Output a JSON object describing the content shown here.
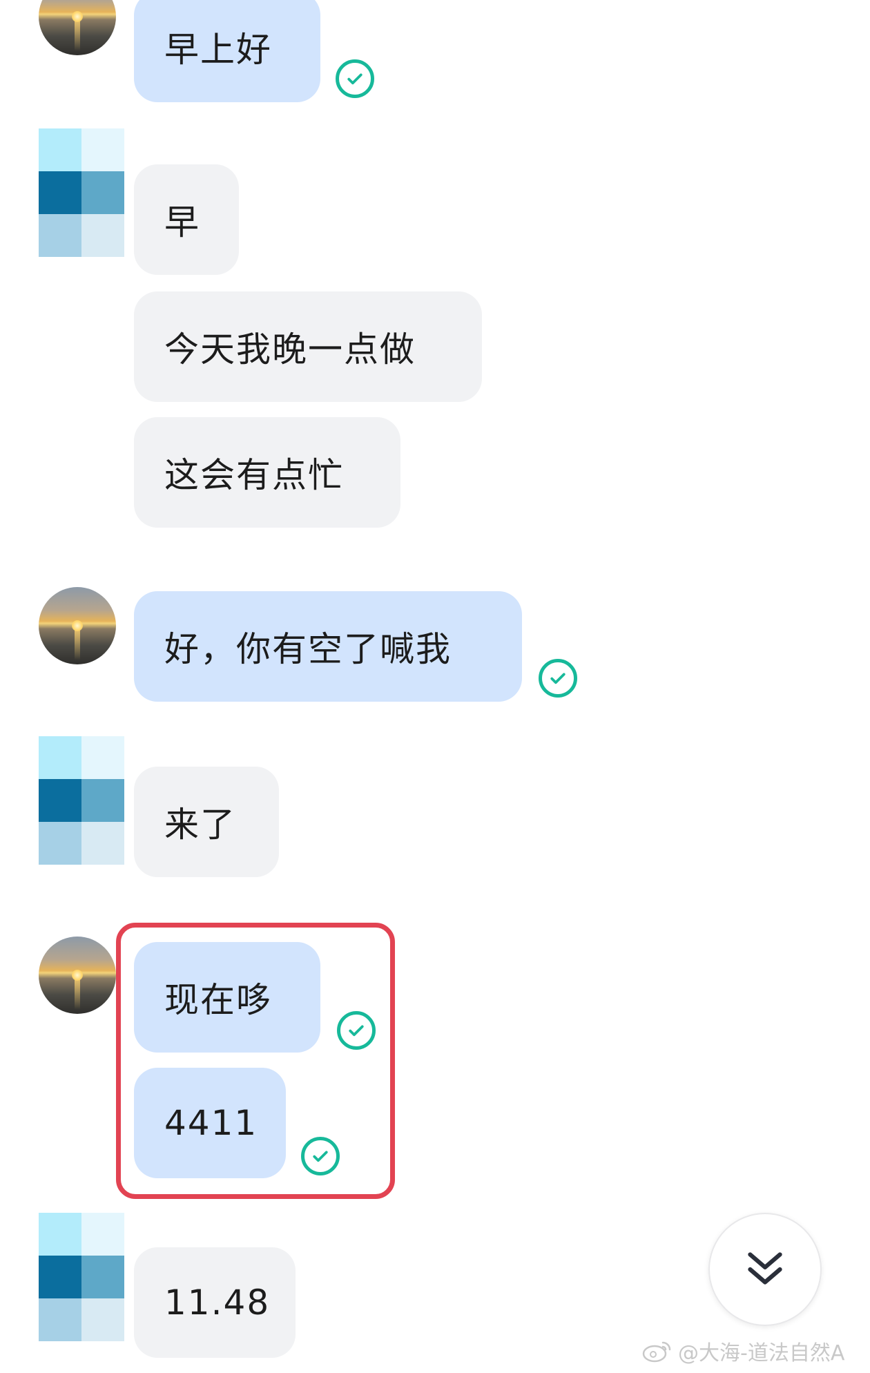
{
  "messages": [
    {
      "text": "早上好",
      "direction": "sent",
      "status": "read"
    },
    {
      "text": "早",
      "direction": "received"
    },
    {
      "text": "今天我晚一点做",
      "direction": "received"
    },
    {
      "text": "这会有点忙",
      "direction": "received"
    },
    {
      "text": "好，你有空了喊我",
      "direction": "sent",
      "status": "read"
    },
    {
      "text": "来了",
      "direction": "received"
    },
    {
      "text": "现在哆",
      "direction": "sent",
      "status": "read",
      "highlighted": true
    },
    {
      "text": "4411",
      "direction": "sent",
      "status": "read",
      "highlighted": true
    },
    {
      "text": "11.48",
      "direction": "received"
    }
  ],
  "watermark": {
    "text": "@大海-道法自然A"
  },
  "icons": {
    "read_check": "check-circle-icon",
    "scroll_down": "double-chevron-down-icon",
    "watermark_logo": "weibo-logo-icon"
  },
  "colors": {
    "sent_bubble": "#d2e4fd",
    "received_bubble": "#f1f2f4",
    "read_check": "#17b99a",
    "highlight": "#e24352",
    "mosaic": [
      "#b3ecfb",
      "#e4f6fd",
      "#0b6e9e",
      "#5ea8c8",
      "#a6d0e6",
      "#d8eaf3"
    ]
  }
}
